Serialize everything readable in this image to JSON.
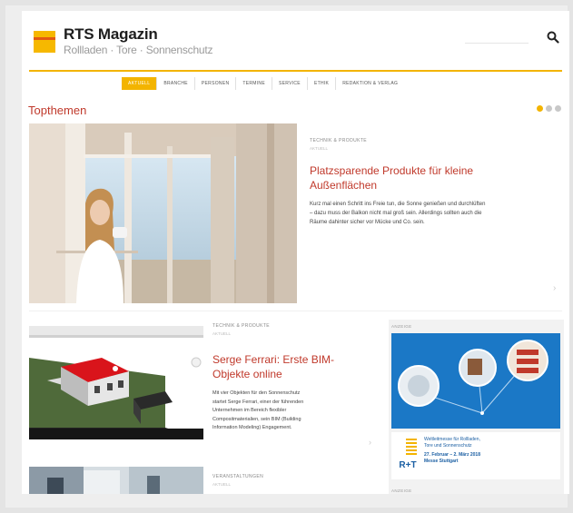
{
  "header": {
    "brand_name": "RTS Magazin",
    "brand_subtitle": "Rollladen · Tore · Sonnenschutz"
  },
  "nav": {
    "items": [
      {
        "label": "AKTUELL",
        "active": true
      },
      {
        "label": "BRANCHE"
      },
      {
        "label": "PERSONEN"
      },
      {
        "label": "TERMINE"
      },
      {
        "label": "SERVICE"
      },
      {
        "label": "ETHIK"
      },
      {
        "label": "REDAKTION & VERLAG"
      }
    ]
  },
  "topthemen": {
    "title": "Topthemen",
    "pager": {
      "pages": 3,
      "current": 1
    }
  },
  "hero": {
    "kicker": "TECHNIK & PRODUKTE",
    "date": "AKTUELL",
    "headline_line1": "Platzsparende Produkte für kleine",
    "headline_line2": "Außenflächen",
    "teaser_line1": "Kurz mal einen Schritt ins Freie tun, die Sonne genießen und durchlüften",
    "teaser_line2": "– dazu muss der Balkon nicht mal groß sein. Allerdings sollten auch die",
    "teaser_line3": "Räume dahinter sicher vor Mücke und Co. sein."
  },
  "article2": {
    "kicker": "TECHNIK & PRODUKTE",
    "date": "AKTUELL",
    "headline_line1": "Serge Ferrari: Erste BIM-",
    "headline_line2": "Objekte online",
    "teaser_line1": "Mit vier Objekten für den Sonnenschutz",
    "teaser_line2": "startet Serge Ferrari, einer der führenden",
    "teaser_line3": "Unternehmen im Bereich flexibler",
    "teaser_line4": "Compositmaterialien, sein BIM (Building",
    "teaser_line5": "Information Modeling) Engagement."
  },
  "article3": {
    "kicker": "VERANSTALTUNGEN",
    "date": "AKTUELL"
  },
  "sidebar": {
    "label_top": "ANZEIGE",
    "label_bottom": "ANZEIGE",
    "ad_line1": "Weltleitmesse für Rollladen,",
    "ad_line2": "Tore und Sonnenschutz",
    "ad_date_line1": "27. Februar – 2. März 2018",
    "ad_date_line2": "Messe Stuttgart",
    "ad_logo": "R+T"
  },
  "colors": {
    "accent_yellow": "#f3b400",
    "headline_red": "#c0392b",
    "ad_blue": "#1b78c6"
  }
}
